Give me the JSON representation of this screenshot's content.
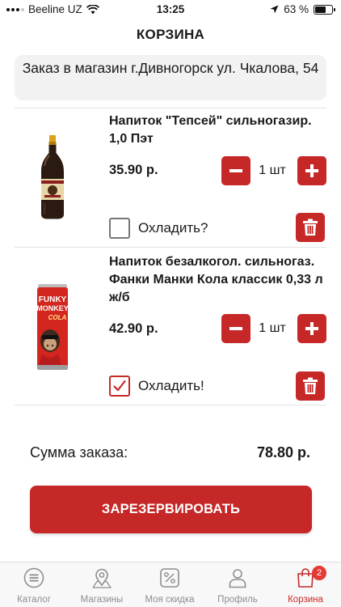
{
  "status_bar": {
    "carrier": "Beeline UZ",
    "time": "13:25",
    "battery_percent": "63 %",
    "battery_level": 0.63
  },
  "header": {
    "title": "КОРЗИНА"
  },
  "store": {
    "text": "Заказ в магазин г.Дивногорск ул. Чкалова, 54"
  },
  "cart_items": [
    {
      "name": "Напиток \"Тепсей\" сильногазир. 1,0 Пэт",
      "price": "35.90 р.",
      "quantity": "1 шт",
      "chill_label": "Охладить?",
      "chill_checked": false
    },
    {
      "name": "Напиток безалкогол. сильногаз. Фанки Манки Кола классик 0,33 л ж/б",
      "price": "42.90 р.",
      "quantity": "1 шт",
      "chill_label": "Охладить!",
      "chill_checked": true,
      "image_text": {
        "line1": "FUNKY",
        "line2": "MONKEY",
        "line3": "COLA"
      }
    }
  ],
  "summary": {
    "label": "Сумма заказа:",
    "value": "78.80 р."
  },
  "reserve_button": {
    "label": "ЗАРЕЗЕРВИРОВАТЬ"
  },
  "tabbar": {
    "tabs": [
      {
        "label": "Каталог",
        "icon": "menu-icon"
      },
      {
        "label": "Магазины",
        "icon": "map-pin-icon"
      },
      {
        "label": "Моя скидка",
        "icon": "percent-icon"
      },
      {
        "label": "Профиль",
        "icon": "user-icon"
      },
      {
        "label": "Корзина",
        "icon": "bag-icon",
        "active": true,
        "badge": "2"
      }
    ]
  },
  "colors": {
    "accent": "#c62828",
    "badge": "#e53935"
  }
}
